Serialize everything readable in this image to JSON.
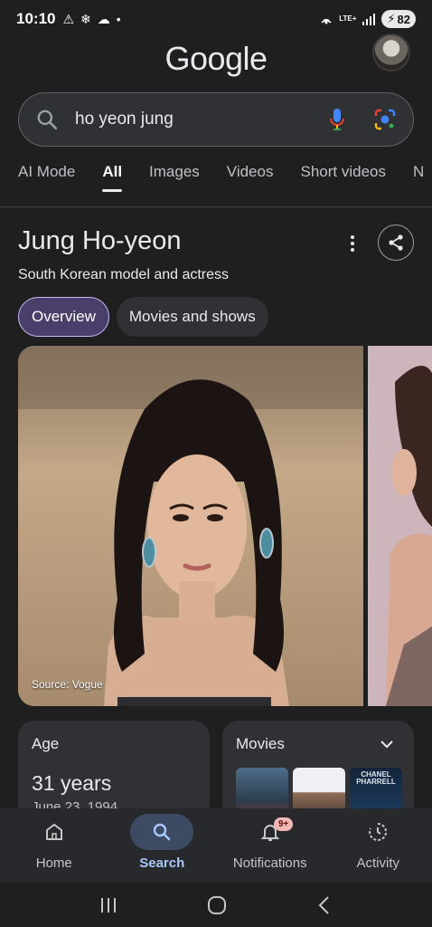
{
  "status_bar": {
    "time": "10:10",
    "network": "LTE+",
    "battery": "82"
  },
  "header": {
    "logo_text": "Google"
  },
  "search": {
    "query": "ho yeon jung"
  },
  "tabs": [
    {
      "label": "AI Mode",
      "active": false
    },
    {
      "label": "All",
      "active": true
    },
    {
      "label": "Images",
      "active": false
    },
    {
      "label": "Videos",
      "active": false
    },
    {
      "label": "Short videos",
      "active": false
    },
    {
      "label": "N",
      "active": false
    }
  ],
  "knowledge_panel": {
    "title": "Jung Ho-yeon",
    "subtitle": "South Korean model and actress",
    "chips": [
      {
        "label": "Overview",
        "active": true
      },
      {
        "label": "Movies and shows",
        "active": false
      }
    ],
    "image_source": "Source: Vogue"
  },
  "cards": {
    "age": {
      "label": "Age",
      "value": "31 years",
      "date": "June 23, 1994"
    },
    "movies": {
      "label": "Movies",
      "thumb_text": "CHANEL PHARRELL"
    }
  },
  "bottom_nav": [
    {
      "label": "Home",
      "icon": "home-icon",
      "active": false
    },
    {
      "label": "Search",
      "icon": "search-icon",
      "active": true
    },
    {
      "label": "Notifications",
      "icon": "bell-icon",
      "active": false,
      "badge": "9+"
    },
    {
      "label": "Activity",
      "icon": "activity-icon",
      "active": false
    }
  ],
  "colors": {
    "background": "#1f1f1f",
    "search_box": "#303134",
    "active_chip": "#4a3f6b",
    "active_nav": "#a8c7fa"
  }
}
